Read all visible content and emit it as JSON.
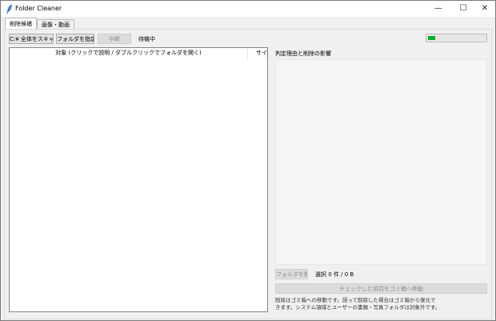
{
  "window": {
    "title": "Folder Cleaner",
    "controls": {
      "minimize": "—",
      "maximize": "☐",
      "close": "✕"
    }
  },
  "tabs": [
    {
      "label": "削除候補",
      "active": true
    },
    {
      "label": "画像・動画",
      "active": false
    }
  ],
  "toolbar": {
    "scan_all_label": "C:¥ 全体をスキャン",
    "choose_folder_label": "フォルダを指定...",
    "stop_label": "中断",
    "status_text": "待機中",
    "progress_fraction": 0.12,
    "progress_color": "#06b025"
  },
  "tree": {
    "columns": [
      "対象 (クリックで説明 / ダブルクリックでフォルダを開く)",
      "サイズ"
    ]
  },
  "details": {
    "title": "判定理由と削除の影響",
    "open_folder_label": "フォルダを開く",
    "selection_text": "選択 0 件 / 0 B",
    "move_to_trash_label": "チェックした項目をゴミ箱へ移動",
    "note_lines": [
      "削除はゴミ箱への移動です。誤って削除した場合はゴミ箱から復元で",
      "きます。システム領域とユーザーの書類・写真フォルダは対象外です。"
    ]
  }
}
